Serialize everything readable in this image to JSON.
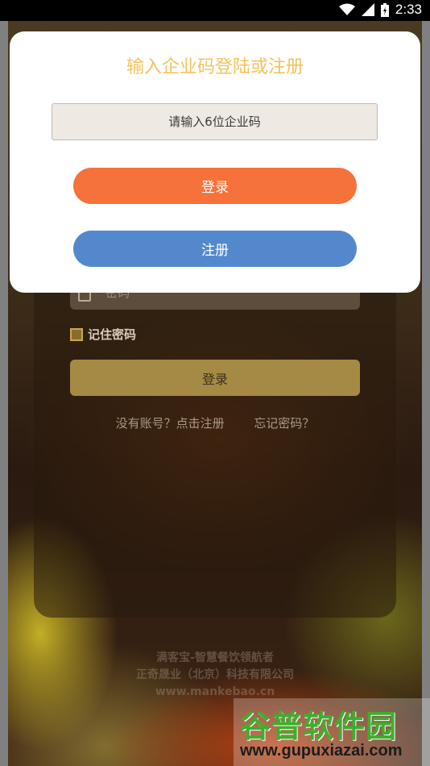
{
  "status_bar": {
    "time": "2:33",
    "icons": [
      "wifi-icon",
      "signal-icon",
      "battery-icon"
    ]
  },
  "dialog": {
    "title": "输入企业码登陆或注册",
    "input_placeholder": "请输入6位企业码",
    "login_label": "登录",
    "register_label": "注册",
    "title_color": "#f3c35a",
    "login_color": "#f5723a",
    "register_color": "#5389cc"
  },
  "background_form": {
    "password_placeholder": "密码",
    "remember_label": "记住密码",
    "login_label": "登录",
    "no_account_link": "没有账号？点击注册",
    "forgot_link": "忘记密码？"
  },
  "footer": {
    "line1": "满客宝-智慧餐饮领航者",
    "line2": "正奇晟业（北京）科技有限公司",
    "line3": "www.mankebao.cn"
  },
  "watermark": {
    "title": "谷普软件园",
    "url": "www.gupuxiazai.com"
  }
}
